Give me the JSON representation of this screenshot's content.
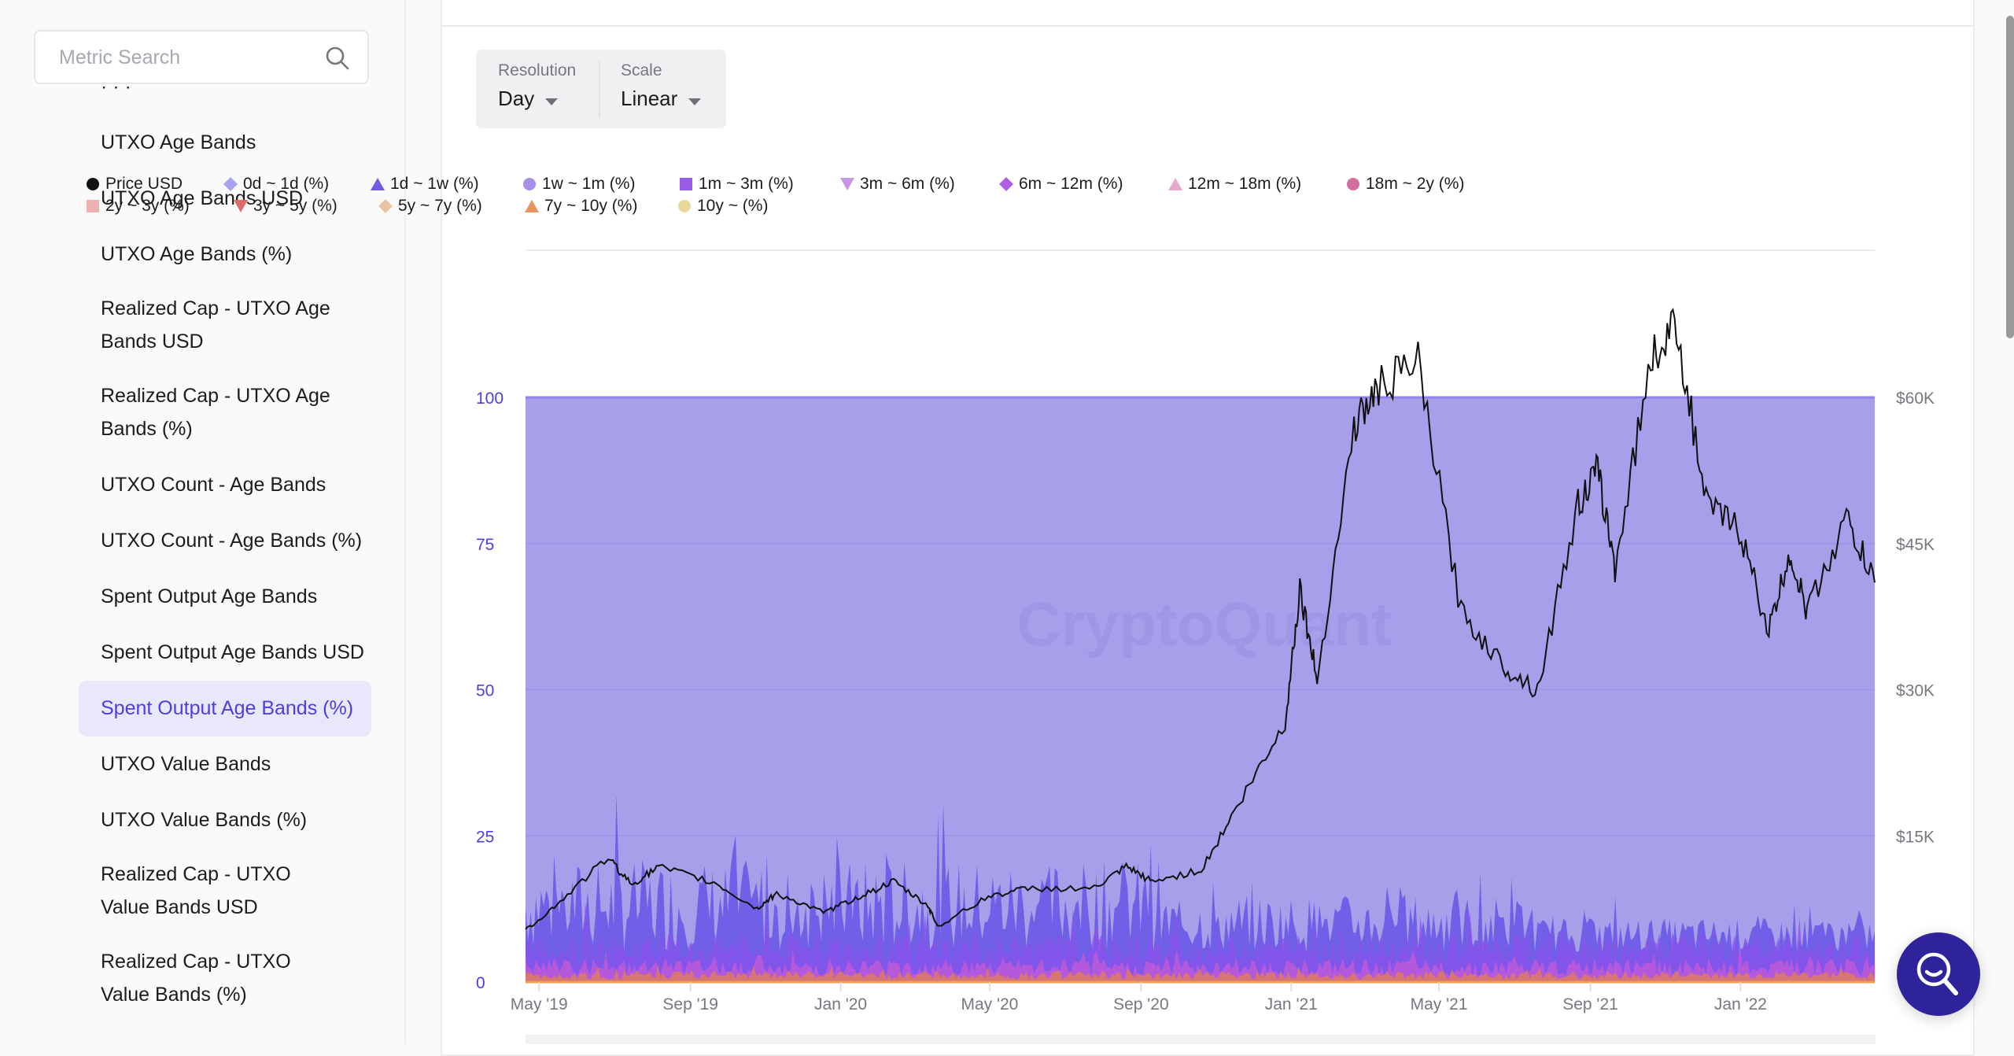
{
  "sidebar": {
    "search_placeholder": "Metric Search",
    "search_icon": "search-icon",
    "items": [
      {
        "label": "UTXO Age Bands",
        "active": false
      },
      {
        "label": "UTXO Age Bands USD",
        "active": false
      },
      {
        "label": "UTXO Age Bands (%)",
        "active": false
      },
      {
        "label": "Realized Cap - UTXO Age Bands USD",
        "active": false
      },
      {
        "label": "Realized Cap - UTXO Age Bands (%)",
        "active": false
      },
      {
        "label": "UTXO Count - Age Bands",
        "active": false
      },
      {
        "label": "UTXO Count - Age Bands (%)",
        "active": false
      },
      {
        "label": "Spent Output Age Bands",
        "active": false
      },
      {
        "label": "Spent Output Age Bands USD",
        "active": false
      },
      {
        "label": "Spent Output Age Bands (%)",
        "active": true
      },
      {
        "label": "UTXO Value Bands",
        "active": false
      },
      {
        "label": "UTXO Value Bands (%)",
        "active": false
      },
      {
        "label": "Realized Cap - UTXO Value Bands USD",
        "active": false
      },
      {
        "label": "Realized Cap - UTXO Value Bands (%)",
        "active": false
      }
    ]
  },
  "controls": {
    "resolution_label": "Resolution",
    "resolution_value": "Day",
    "scale_label": "Scale",
    "scale_value": "Linear"
  },
  "colors": {
    "accent": "#4d3ee0",
    "active_bg": "#e9e8fa",
    "fab": "#2e239a",
    "area_top": "#a89fea"
  },
  "watermark": "CryptoQuant",
  "fab_icon": "search-smile-icon",
  "chart_data": {
    "type": "area",
    "title": "Spent Output Age Bands (%)",
    "legend_position": "top",
    "legend": [
      {
        "name": "Price USD",
        "marker": "circle",
        "color": "#111111"
      },
      {
        "name": "0d ~ 1d (%)",
        "marker": "diamond",
        "color": "#a8a3ee"
      },
      {
        "name": "1d ~ 1w (%)",
        "marker": "triangle-up",
        "color": "#6e5ce6"
      },
      {
        "name": "1w ~ 1m (%)",
        "marker": "circle",
        "color": "#a68fe6"
      },
      {
        "name": "1m ~ 3m (%)",
        "marker": "square",
        "color": "#9a5ce8"
      },
      {
        "name": "3m ~ 6m (%)",
        "marker": "triangle-down",
        "color": "#c797e6"
      },
      {
        "name": "6m ~ 12m (%)",
        "marker": "diamond",
        "color": "#b05ee0"
      },
      {
        "name": "12m ~ 18m (%)",
        "marker": "triangle-up",
        "color": "#e8a7cc"
      },
      {
        "name": "18m ~ 2y (%)",
        "marker": "circle",
        "color": "#d46e9e"
      },
      {
        "name": "2y ~ 3y (%)",
        "marker": "square",
        "color": "#eeb0b0"
      },
      {
        "name": "3y ~ 5y (%)",
        "marker": "triangle-down",
        "color": "#de6b6b"
      },
      {
        "name": "5y ~ 7y (%)",
        "marker": "diamond",
        "color": "#ecc3a0"
      },
      {
        "name": "7y ~ 10y (%)",
        "marker": "triangle-up",
        "color": "#e8935e"
      },
      {
        "name": "10y ~ (%)",
        "marker": "circle",
        "color": "#e8d89a"
      }
    ],
    "x_ticks": [
      "May '19",
      "Sep '19",
      "Jan '20",
      "May '20",
      "Sep '20",
      "Jan '21",
      "May '21",
      "Sep '21",
      "Jan '22"
    ],
    "x_range": [
      "2019-04-20",
      "2022-04-20"
    ],
    "y_left": {
      "ticks": [
        "0",
        "25",
        "50",
        "75",
        "100"
      ],
      "range": [
        0,
        100
      ],
      "label_color": "#4d3ee0"
    },
    "y_right": {
      "ticks": [
        "$15K",
        "$30K",
        "$45K",
        "$60K"
      ],
      "range": [
        0,
        60000
      ]
    },
    "grid": true,
    "stack_total_pct": 100,
    "price_usd_approx": {
      "dates": [
        "2019-04-20",
        "2019-05-15",
        "2019-06-26",
        "2019-07-15",
        "2019-08-06",
        "2019-09-20",
        "2019-10-25",
        "2019-11-10",
        "2019-12-18",
        "2020-01-15",
        "2020-02-13",
        "2020-03-12",
        "2020-03-20",
        "2020-04-30",
        "2020-06-01",
        "2020-07-25",
        "2020-08-20",
        "2020-09-10",
        "2020-10-20",
        "2020-11-20",
        "2020-12-27",
        "2021-01-08",
        "2021-01-22",
        "2021-02-21",
        "2021-03-13",
        "2021-04-14",
        "2021-05-19",
        "2021-06-22",
        "2021-07-20",
        "2021-08-22",
        "2021-09-07",
        "2021-09-21",
        "2021-10-20",
        "2021-11-10",
        "2021-12-04",
        "2021-12-31",
        "2022-01-24",
        "2022-02-10",
        "2022-02-24",
        "2022-03-28",
        "2022-04-20"
      ],
      "values": [
        5300,
        7900,
        12800,
        10000,
        11800,
        10200,
        7500,
        9100,
        7100,
        8700,
        10300,
        7800,
        5700,
        8800,
        9600,
        9600,
        11800,
        10300,
        11500,
        18400,
        26500,
        40500,
        31000,
        57000,
        61000,
        63500,
        38000,
        32500,
        30000,
        49000,
        52500,
        42500,
        64000,
        67500,
        49000,
        46500,
        36000,
        44000,
        38000,
        47500,
        41000
      ]
    }
  }
}
